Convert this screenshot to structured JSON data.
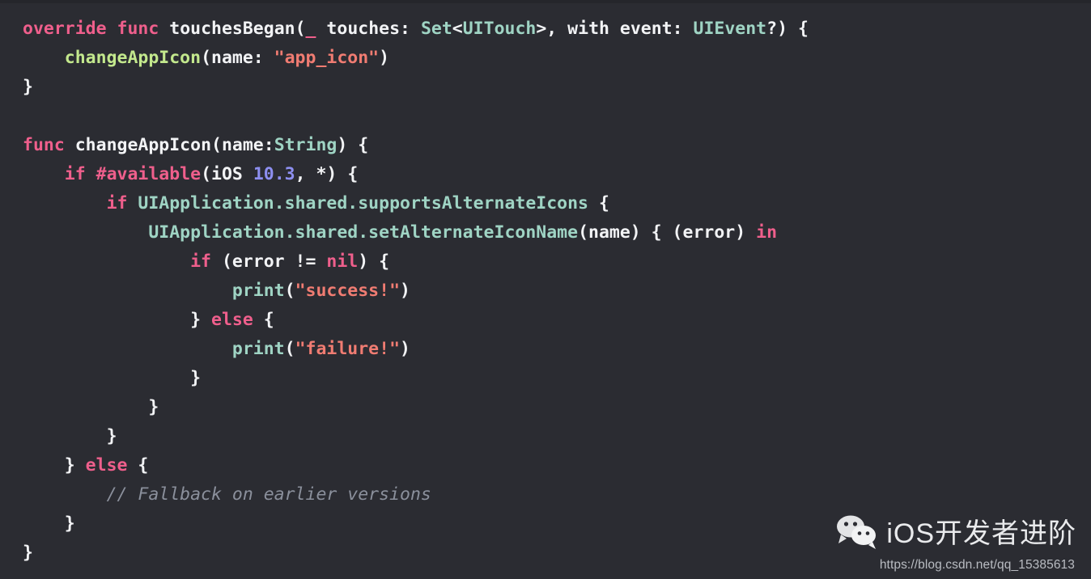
{
  "editor": {
    "language": "Swift",
    "background_color": "#2b2c32",
    "colors": {
      "keyword": "#ef5f8c",
      "type": "#9fd4c4",
      "function": "#c3e88d",
      "string": "#f07c72",
      "number": "#8d8ff0",
      "plain": "#f2f3f5",
      "comment": "#8b909c"
    },
    "lines": [
      {
        "n": 1,
        "indent": 0,
        "tokens": [
          {
            "t": "override",
            "c": "kw"
          },
          {
            "t": " ",
            "c": "pln"
          },
          {
            "t": "func",
            "c": "kw"
          },
          {
            "t": " ",
            "c": "pln"
          },
          {
            "t": "touchesBegan(",
            "c": "pln"
          },
          {
            "t": "_",
            "c": "kw"
          },
          {
            "t": " touches: ",
            "c": "pln"
          },
          {
            "t": "Set",
            "c": "typ"
          },
          {
            "t": "<",
            "c": "pln"
          },
          {
            "t": "UITouch",
            "c": "typ"
          },
          {
            "t": ">, with event: ",
            "c": "pln"
          },
          {
            "t": "UIEvent",
            "c": "typ"
          },
          {
            "t": "?) {",
            "c": "pln"
          }
        ]
      },
      {
        "n": 2,
        "indent": 1,
        "tokens": [
          {
            "t": "changeAppIcon",
            "c": "fn"
          },
          {
            "t": "(name: ",
            "c": "pln"
          },
          {
            "t": "\"app_icon\"",
            "c": "str"
          },
          {
            "t": ")",
            "c": "pln"
          }
        ]
      },
      {
        "n": 3,
        "indent": 0,
        "tokens": [
          {
            "t": "}",
            "c": "pln"
          }
        ]
      },
      {
        "n": 4,
        "indent": 0,
        "tokens": []
      },
      {
        "n": 5,
        "indent": 0,
        "tokens": [
          {
            "t": "func",
            "c": "kw"
          },
          {
            "t": " ",
            "c": "pln"
          },
          {
            "t": "changeAppIcon(name:",
            "c": "pln"
          },
          {
            "t": "String",
            "c": "typ"
          },
          {
            "t": ") {",
            "c": "pln"
          }
        ]
      },
      {
        "n": 6,
        "indent": 1,
        "tokens": [
          {
            "t": "if",
            "c": "kw"
          },
          {
            "t": " ",
            "c": "pln"
          },
          {
            "t": "#available",
            "c": "kw"
          },
          {
            "t": "(iOS ",
            "c": "pln"
          },
          {
            "t": "10.3",
            "c": "num"
          },
          {
            "t": ", *) {",
            "c": "pln"
          }
        ]
      },
      {
        "n": 7,
        "indent": 2,
        "tokens": [
          {
            "t": "if",
            "c": "kw"
          },
          {
            "t": " ",
            "c": "pln"
          },
          {
            "t": "UIApplication.shared.supportsAlternateIcons",
            "c": "typ"
          },
          {
            "t": " {",
            "c": "pln"
          }
        ]
      },
      {
        "n": 8,
        "indent": 3,
        "tokens": [
          {
            "t": "UIApplication.shared.setAlternateIconName",
            "c": "typ"
          },
          {
            "t": "(name) { (error) ",
            "c": "pln"
          },
          {
            "t": "in",
            "c": "kw"
          }
        ]
      },
      {
        "n": 9,
        "indent": 4,
        "tokens": [
          {
            "t": "if",
            "c": "kw"
          },
          {
            "t": " (error != ",
            "c": "pln"
          },
          {
            "t": "nil",
            "c": "kw"
          },
          {
            "t": ") {",
            "c": "pln"
          }
        ]
      },
      {
        "n": 10,
        "indent": 5,
        "tokens": [
          {
            "t": "print",
            "c": "typ"
          },
          {
            "t": "(",
            "c": "pln"
          },
          {
            "t": "\"success!\"",
            "c": "str"
          },
          {
            "t": ")",
            "c": "pln"
          }
        ]
      },
      {
        "n": 11,
        "indent": 4,
        "tokens": [
          {
            "t": "} ",
            "c": "pln"
          },
          {
            "t": "else",
            "c": "kw"
          },
          {
            "t": " {",
            "c": "pln"
          }
        ]
      },
      {
        "n": 12,
        "indent": 5,
        "tokens": [
          {
            "t": "print",
            "c": "typ"
          },
          {
            "t": "(",
            "c": "pln"
          },
          {
            "t": "\"failure!\"",
            "c": "str"
          },
          {
            "t": ")",
            "c": "pln"
          }
        ]
      },
      {
        "n": 13,
        "indent": 4,
        "tokens": [
          {
            "t": "}",
            "c": "pln"
          }
        ]
      },
      {
        "n": 14,
        "indent": 3,
        "tokens": [
          {
            "t": "}",
            "c": "pln"
          }
        ]
      },
      {
        "n": 15,
        "indent": 2,
        "tokens": [
          {
            "t": "}",
            "c": "pln"
          }
        ]
      },
      {
        "n": 16,
        "indent": 1,
        "tokens": [
          {
            "t": "} ",
            "c": "pln"
          },
          {
            "t": "else",
            "c": "kw"
          },
          {
            "t": " {",
            "c": "pln"
          }
        ]
      },
      {
        "n": 17,
        "indent": 2,
        "tokens": [
          {
            "t": "// Fallback on earlier versions",
            "c": "cmt"
          }
        ]
      },
      {
        "n": 18,
        "indent": 1,
        "tokens": [
          {
            "t": "}",
            "c": "pln"
          }
        ]
      },
      {
        "n": 19,
        "indent": 0,
        "tokens": [
          {
            "t": "}",
            "c": "pln"
          }
        ]
      }
    ]
  },
  "watermark": {
    "logo_icon": "wechat-icon",
    "title": "iOS开发者进阶",
    "url": "https://blog.csdn.net/qq_15385613"
  }
}
